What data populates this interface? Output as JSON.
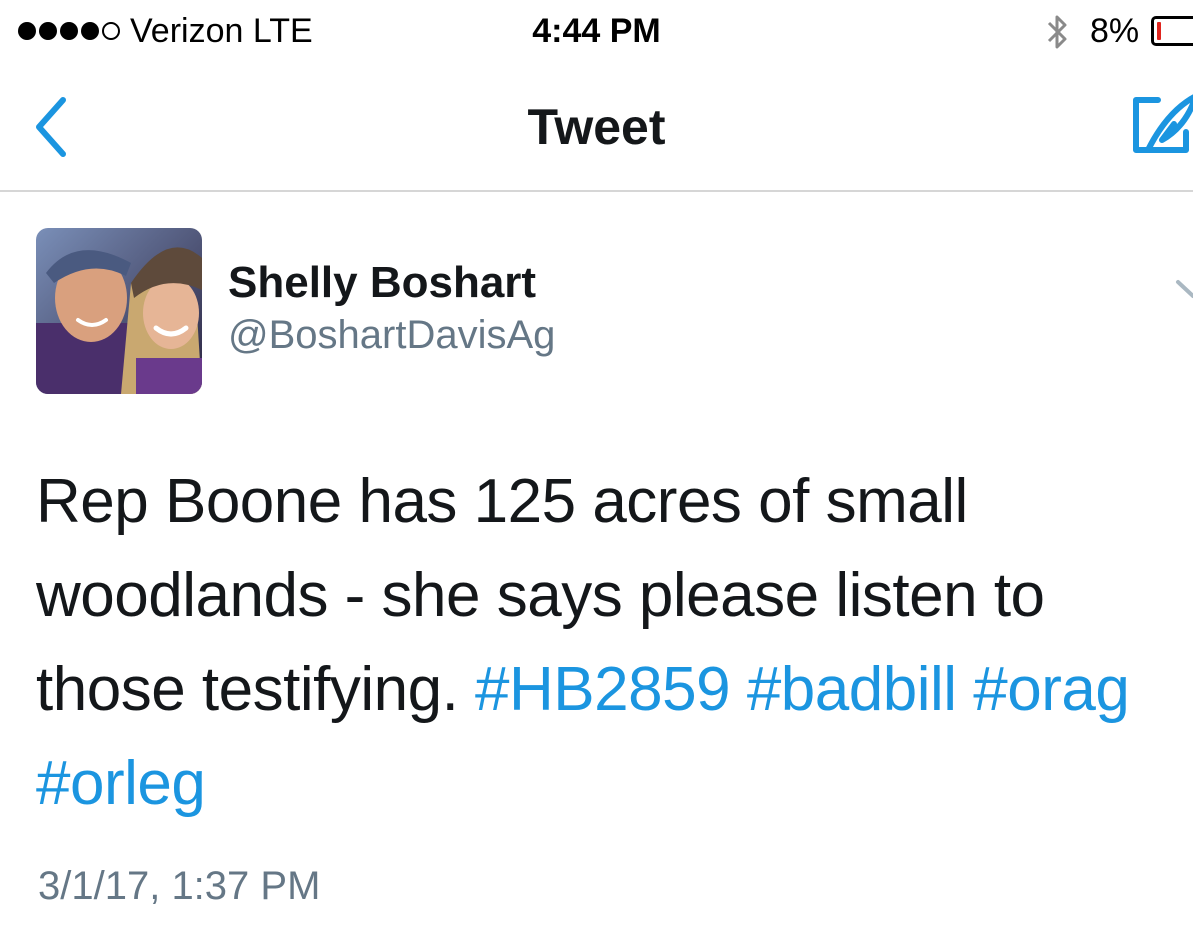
{
  "status_bar": {
    "carrier": "Verizon  LTE",
    "time": "4:44 PM",
    "battery_percent": "8%",
    "battery_level": 0.08,
    "icons": [
      "signal-dots",
      "bluetooth-icon",
      "battery-icon"
    ]
  },
  "nav": {
    "title": "Tweet",
    "back_icon": "chevron-left-icon",
    "compose_icon": "compose-tweet-icon"
  },
  "tweet": {
    "author_name": "Shelly Boshart",
    "author_handle": "@BoshartDavisAg",
    "text_lines": [
      "Rep Boone has 125 acres of small",
      "woodlands - she says please listen to",
      "those testifying."
    ],
    "hashtags": [
      "#HB2859",
      "#badbill",
      "#orag",
      "#orleg"
    ],
    "timestamp": "3/1/17, 1:37 PM"
  },
  "colors": {
    "accent": "#1b95e0",
    "text": "#14171a",
    "secondary_text": "#657786",
    "divider": "#d6d6d6",
    "battery_low": "#e0251e"
  }
}
